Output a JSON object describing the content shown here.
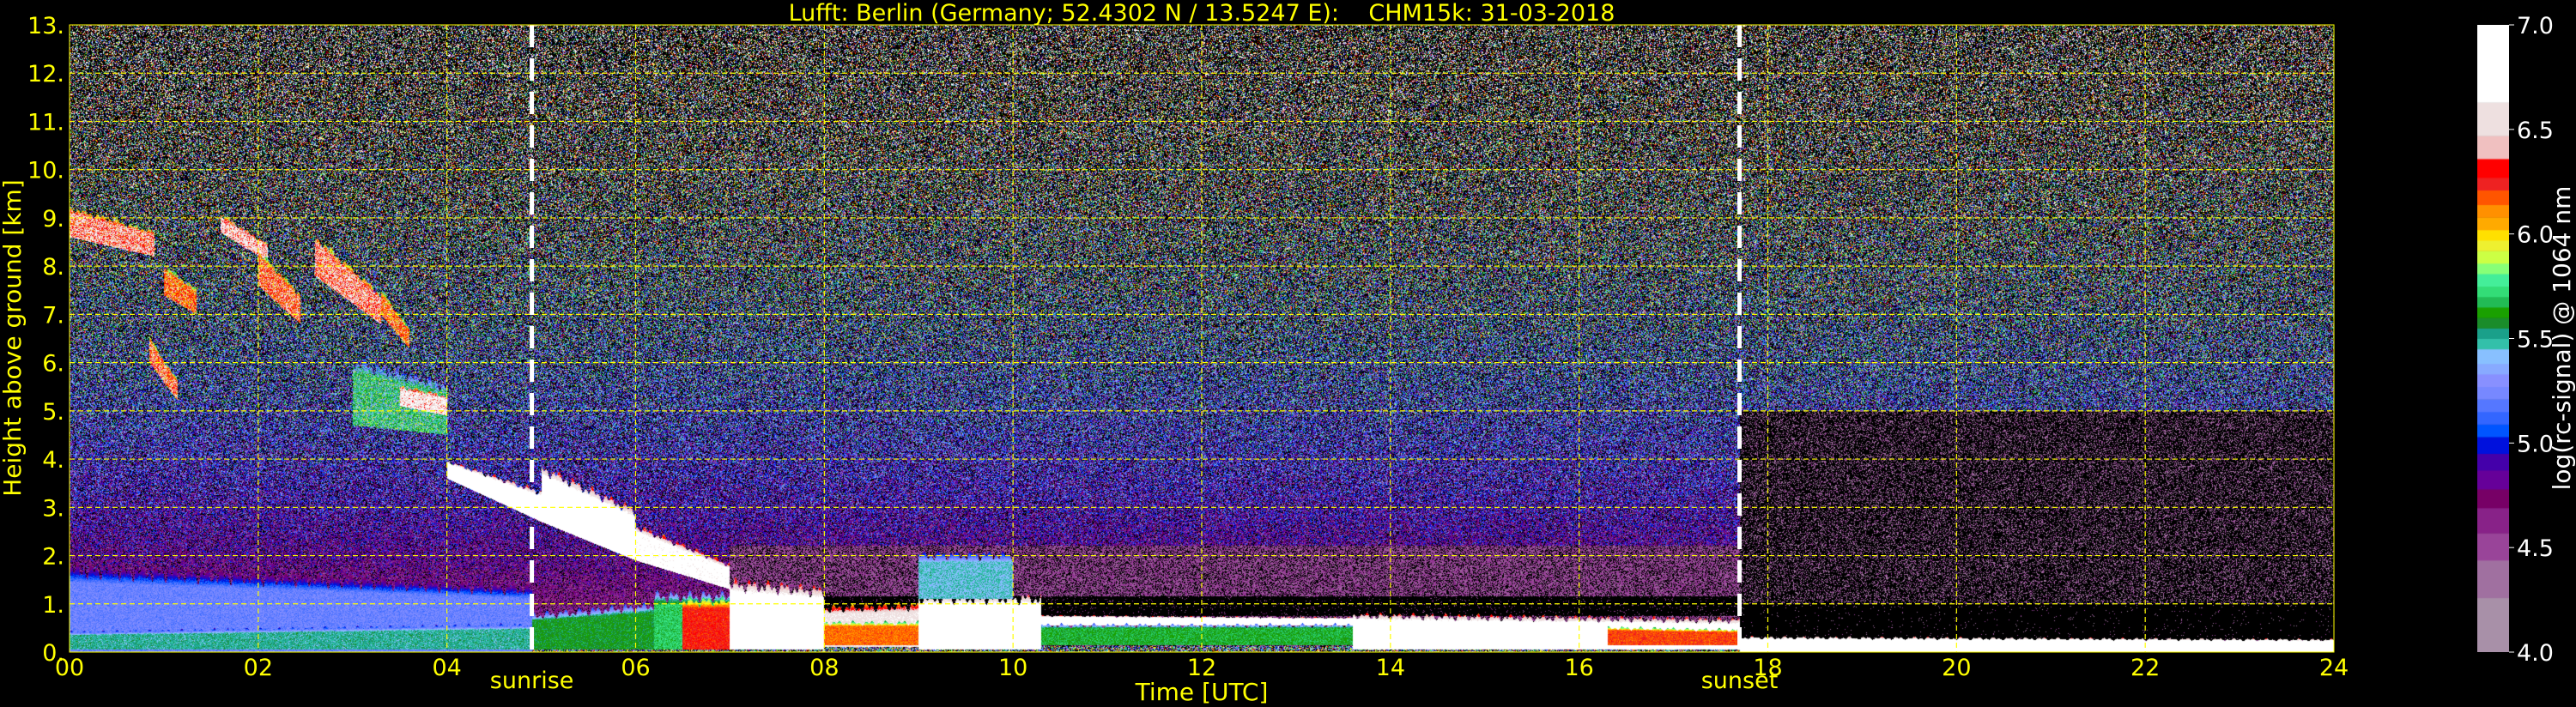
{
  "chart_data": {
    "type": "heatmap",
    "title": "Lufft: Berlin (Germany; 52.4302 N / 13.5247 E):    CHM15k: 31-03-2018",
    "xlabel": "Time [UTC]",
    "ylabel": "Height above ground [km]",
    "xlim": [
      0,
      24
    ],
    "ylim": [
      0,
      13
    ],
    "xticks": [
      0,
      2,
      4,
      6,
      8,
      10,
      12,
      14,
      16,
      18,
      20,
      22,
      24
    ],
    "xtick_labels": [
      "00",
      "02",
      "04",
      "06",
      "08",
      "10",
      "12",
      "14",
      "16",
      "18",
      "20",
      "22",
      "24"
    ],
    "yticks": [
      0,
      1,
      2,
      3,
      4,
      5,
      6,
      7,
      8,
      9,
      10,
      11,
      12,
      13
    ],
    "ytick_labels": [
      "0.",
      "1.",
      "2.",
      "3.",
      "4.",
      "5.",
      "6.",
      "7.",
      "8.",
      "9.",
      "10.",
      "11.",
      "12.",
      "13."
    ],
    "grid": true,
    "grid_color": "#ffff00",
    "markers": [
      {
        "label": "sunrise",
        "time": 4.9
      },
      {
        "label": "sunset",
        "time": 17.7
      }
    ],
    "colorbar": {
      "label": "log(rc-signal) @ 1064 nm",
      "range": [
        4.0,
        7.0
      ],
      "ticks": [
        4.0,
        4.5,
        5.0,
        5.5,
        6.0,
        6.5,
        7.0
      ],
      "tick_labels": [
        "4.0",
        "4.5",
        "5.0",
        "5.5",
        "6.0",
        "6.5",
        "7.0"
      ],
      "bounds": [
        4.0,
        4.26,
        4.44,
        4.57,
        4.69,
        4.78,
        4.87,
        4.95,
        5.03,
        5.09,
        5.15,
        5.21,
        5.27,
        5.33,
        5.38,
        5.45,
        5.5,
        5.55,
        5.6,
        5.65,
        5.7,
        5.75,
        5.81,
        5.86,
        5.92,
        5.97,
        6.02,
        6.08,
        6.14,
        6.21,
        6.27,
        6.36,
        6.47,
        6.63,
        7.0
      ],
      "colors": [
        "#a890a8",
        "#a070a0",
        "#994499",
        "#882288",
        "#770066",
        "#660099",
        "#4400aa",
        "#0011dd",
        "#0055ff",
        "#3366ff",
        "#5577ff",
        "#7788ff",
        "#8890ff",
        "#88aaff",
        "#88c0ff",
        "#33c0aa",
        "#1aa08a",
        "#1a8c2a",
        "#1aa000",
        "#22bb55",
        "#33dd77",
        "#44ee99",
        "#88ff77",
        "#ccff44",
        "#eef030",
        "#ffe000",
        "#ffaa00",
        "#ff9000",
        "#ff5500",
        "#ee2222",
        "#ff0000",
        "#f0c0c0",
        "#eee0e0",
        "#ffffff"
      ]
    },
    "features": [
      {
        "t0": 0.0,
        "t1": 4.9,
        "h0": 0.0,
        "h1": 0.0,
        "thick0": 1.7,
        "thick1": 1.3,
        "value": 5.22
      },
      {
        "t0": 0.0,
        "t1": 4.9,
        "h0": 0.05,
        "h1": 0.05,
        "thick0": 0.35,
        "thick1": 0.5,
        "value": 5.5
      },
      {
        "t0": 4.9,
        "t1": 6.2,
        "h0": 0.05,
        "h1": 0.05,
        "thick0": 0.7,
        "thick1": 0.9,
        "value": 5.6
      },
      {
        "t0": 6.2,
        "t1": 7.3,
        "h0": 0.05,
        "h1": 0.05,
        "thick0": 1.1,
        "thick1": 1.1,
        "value": 5.7
      },
      {
        "t0": 0.0,
        "t1": 0.9,
        "h0": 8.6,
        "h1": 8.2,
        "thick0": 0.6,
        "thick1": 0.5,
        "value": 6.4
      },
      {
        "t0": 0.85,
        "t1": 1.15,
        "h0": 6.0,
        "h1": 5.2,
        "thick0": 0.5,
        "thick1": 0.4,
        "value": 6.3
      },
      {
        "t0": 1.0,
        "t1": 1.35,
        "h0": 7.4,
        "h1": 7.0,
        "thick0": 0.6,
        "thick1": 0.5,
        "value": 6.2
      },
      {
        "t0": 1.6,
        "t1": 2.1,
        "h0": 8.7,
        "h1": 8.1,
        "thick0": 0.35,
        "thick1": 0.35,
        "value": 6.5
      },
      {
        "t0": 2.0,
        "t1": 2.45,
        "h0": 7.6,
        "h1": 6.8,
        "thick0": 0.7,
        "thick1": 0.6,
        "value": 6.3
      },
      {
        "t0": 2.6,
        "t1": 3.3,
        "h0": 7.8,
        "h1": 6.8,
        "thick0": 0.8,
        "thick1": 0.6,
        "value": 6.4
      },
      {
        "t0": 3.3,
        "t1": 3.6,
        "h0": 7.0,
        "h1": 6.3,
        "thick0": 0.5,
        "thick1": 0.4,
        "value": 6.2
      },
      {
        "t0": 3.0,
        "t1": 4.0,
        "h0": 4.7,
        "h1": 4.5,
        "thick0": 1.3,
        "thick1": 1.0,
        "value": 5.6
      },
      {
        "t0": 3.5,
        "t1": 4.0,
        "h0": 5.1,
        "h1": 4.9,
        "thick0": 0.4,
        "thick1": 0.4,
        "value": 6.6
      },
      {
        "t0": 4.0,
        "t1": 5.0,
        "h0": 3.6,
        "h1": 2.7,
        "thick0": 0.35,
        "thick1": 0.6,
        "value": 6.8
      },
      {
        "t0": 5.0,
        "t1": 6.0,
        "h0": 2.7,
        "h1": 1.9,
        "thick0": 1.1,
        "thick1": 1.0,
        "value": 6.8
      },
      {
        "t0": 6.0,
        "t1": 7.0,
        "h0": 1.9,
        "h1": 1.3,
        "thick0": 0.7,
        "thick1": 0.5,
        "value": 6.7
      },
      {
        "t0": 6.5,
        "t1": 7.0,
        "h0": 0.05,
        "h1": 0.05,
        "thick0": 1.0,
        "thick1": 1.0,
        "value": 6.25
      },
      {
        "t0": 7.0,
        "t1": 8.0,
        "h0": 0.05,
        "h1": 0.05,
        "thick0": 1.35,
        "thick1": 1.2,
        "value": 6.8
      },
      {
        "t0": 8.0,
        "t1": 10.3,
        "h0": 0.1,
        "h1": 0.1,
        "thick0": 0.8,
        "thick1": 0.9,
        "value": 6.6
      },
      {
        "t0": 8.0,
        "t1": 9.0,
        "h0": 0.15,
        "h1": 0.15,
        "thick0": 0.45,
        "thick1": 0.45,
        "value": 6.15
      },
      {
        "t0": 9.0,
        "t1": 10.3,
        "h0": 0.05,
        "h1": 0.05,
        "thick0": 1.05,
        "thick1": 1.05,
        "value": 6.85
      },
      {
        "t0": 9.0,
        "t1": 10.0,
        "h0": 1.1,
        "h1": 1.1,
        "thick0": 0.9,
        "thick1": 0.9,
        "value": 5.45
      },
      {
        "t0": 10.3,
        "t1": 14.0,
        "h0": 0.55,
        "h1": 0.55,
        "thick0": 0.2,
        "thick1": 0.15,
        "value": 6.8
      },
      {
        "t0": 10.3,
        "t1": 13.6,
        "h0": 0.15,
        "h1": 0.15,
        "thick0": 0.4,
        "thick1": 0.4,
        "value": 5.65
      },
      {
        "t0": 13.6,
        "t1": 17.7,
        "h0": 0.05,
        "h1": 0.05,
        "thick0": 0.7,
        "thick1": 0.6,
        "value": 6.8
      },
      {
        "t0": 16.3,
        "t1": 17.7,
        "h0": 0.15,
        "h1": 0.15,
        "thick0": 0.35,
        "thick1": 0.3,
        "value": 6.2
      },
      {
        "t0": 17.7,
        "t1": 24.0,
        "h0": 0.0,
        "h1": 0.0,
        "thick0": 0.3,
        "thick1": 0.25,
        "value": 6.9
      }
    ],
    "clear_zones": [
      {
        "t0": 7.0,
        "t1": 17.7,
        "h0": 0.75,
        "h1": 1.15
      },
      {
        "t0": 17.7,
        "t1": 24.0,
        "h0": 0.25,
        "h1": 1.0
      }
    ]
  }
}
